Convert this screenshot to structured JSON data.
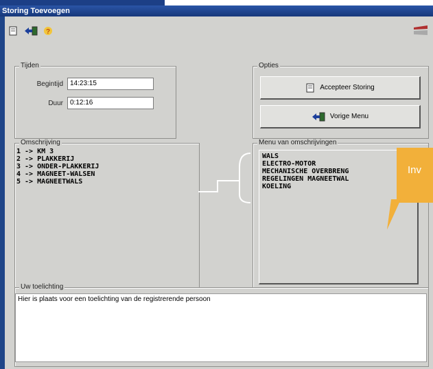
{
  "window": {
    "title": "Storing Toevoegen"
  },
  "toolbar": {
    "icons": [
      "document-icon",
      "back-arrow-icon",
      "help-question-icon",
      "logo-icon"
    ]
  },
  "tijden": {
    "legend": "Tijden",
    "begintijd_label": "Begintijd",
    "begintijd_value": "14:23:15",
    "duur_label": "Duur",
    "duur_value": "0:12:16"
  },
  "opties": {
    "legend": "Opties",
    "accept_label": "Accepteer Storing",
    "back_label": "Vorige Menu"
  },
  "omschrijving": {
    "legend": "Omschrijving",
    "items": [
      "1 -> KM 3",
      "2 -> PLAKKERIJ",
      "3 -> ONDER-PLAKKERIJ",
      "4 -> MAGNEET-WALSEN",
      "5 -> MAGNEETWALS"
    ]
  },
  "menu": {
    "legend": "Menu van omschrijvingen",
    "items": [
      "WALS",
      "ELECTRO-MOTOR",
      "MECHANISCHE OVERBRENG",
      "REGELINGEN MAGNEETWAL",
      "KOELING"
    ]
  },
  "toelichting": {
    "legend": "Uw toelichting",
    "text": "Hier is plaats voor een toelichting van de registrerende persoon"
  },
  "callout": {
    "text": "Inv"
  },
  "colors": {
    "titlebar": "#1f4588",
    "client": "#d2d2cf",
    "callout": "#f2b03a",
    "connector": "#ffffff"
  }
}
